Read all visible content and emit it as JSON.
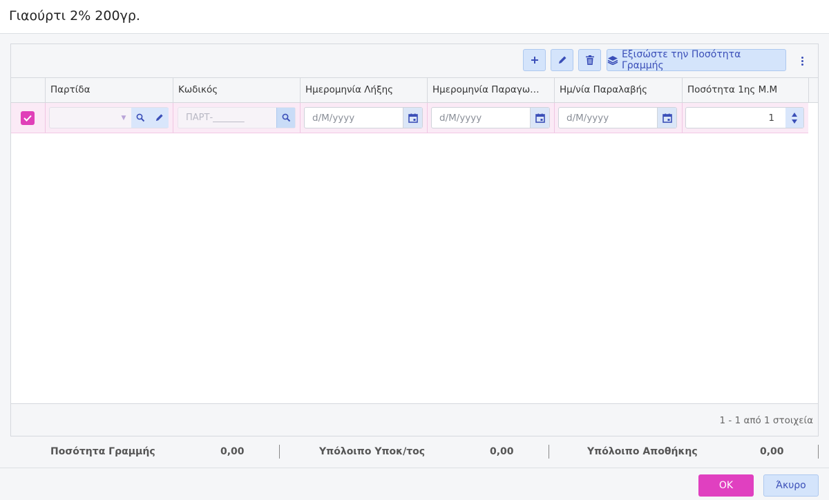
{
  "dialog": {
    "title": "Γιαούρτι 2% 200γρ."
  },
  "toolbar": {
    "add_icon": "plus-icon",
    "edit_icon": "pencil-icon",
    "delete_icon": "trash-icon",
    "equalize_icon": "layers-icon",
    "equalize_label": "Εξισώστε την Ποσότητα Γραμμής",
    "more_icon": "kebab-menu-icon"
  },
  "columns": [
    "Παρτίδα",
    "Κωδικός",
    "Ημερομηνία Λήξης",
    "Ημερομηνία Παραγωγής",
    "Ημ/νία Παραλαβής",
    "Ποσότητα 1ης Μ.Μ"
  ],
  "row": {
    "selected": true,
    "batch_value": "",
    "code_placeholder": "ΠΑΡΤ-_______",
    "expiry_placeholder": "d/M/yyyy",
    "production_placeholder": "d/M/yyyy",
    "receipt_placeholder": "d/M/yyyy",
    "quantity": "1"
  },
  "pager": {
    "info": "1 - 1 από 1 στοιχεία"
  },
  "summary": {
    "line_qty_label": "Ποσότητα Γραμμής",
    "line_qty_value": "0,00",
    "sub_balance_label": "Υπόλοιπο Υποκ/τος",
    "sub_balance_value": "0,00",
    "warehouse_balance_label": "Υπόλοιπο Αποθήκης",
    "warehouse_balance_value": "0,00"
  },
  "footer": {
    "ok_label": "OK",
    "cancel_label": "Άκυρο"
  },
  "colors": {
    "accent": "#e040c0",
    "primary": "#3b4fb8",
    "button_bg": "#d4e4fb",
    "row_selected": "#fbeaf6"
  }
}
